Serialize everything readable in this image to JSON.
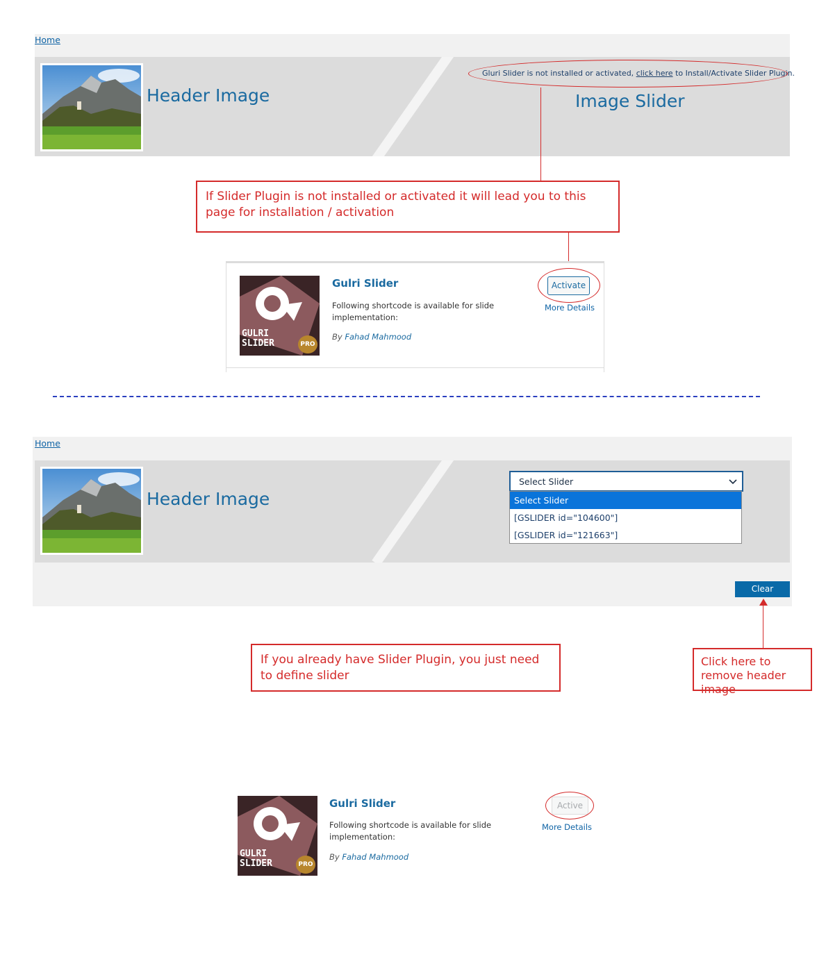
{
  "section1": {
    "breadcrumb": "Home",
    "header_label": "Header Image",
    "notice_prefix": "Gluri Slider is not installed or activated,",
    "notice_link": "click here",
    "notice_suffix": "to Install/Activate Slider Plugin.",
    "slider_label": "Image Slider",
    "annotation": "If Slider Plugin is not installed or activated it will lead you to this page for installation / activation",
    "plugin": {
      "name": "Gulri Slider",
      "description": "Following shortcode is available for slide implementation:",
      "by_prefix": "By",
      "author": "Fahad Mahmood",
      "action_label": "Activate",
      "more_details": "More Details",
      "logo_line1": "GULRI",
      "logo_line2": "SLIDER",
      "logo_badge": "PRO"
    }
  },
  "section2": {
    "breadcrumb": "Home",
    "header_label": "Header Image",
    "select": {
      "value": "Select Slider",
      "options": [
        "Select Slider",
        "[GSLIDER id=\"104600\"]",
        "[GSLIDER id=\"121663\"]"
      ]
    },
    "clear_label": "Clear",
    "annotation_define": "If you already have Slider Plugin, you just need to define slider",
    "annotation_remove": "Click here to remove header image",
    "plugin": {
      "name": "Gulri Slider",
      "description": "Following shortcode is available for slide implementation:",
      "by_prefix": "By",
      "author": "Fahad Mahmood",
      "action_label": "Active",
      "more_details": "More Details",
      "logo_line1": "GULRI",
      "logo_line2": "SLIDER",
      "logo_badge": "PRO"
    }
  },
  "colors": {
    "accent_blue": "#1a6aa0",
    "annotation_red": "#d42a2a",
    "separator_blue": "#2a3fbf",
    "clear_button": "#0a6aa8"
  }
}
